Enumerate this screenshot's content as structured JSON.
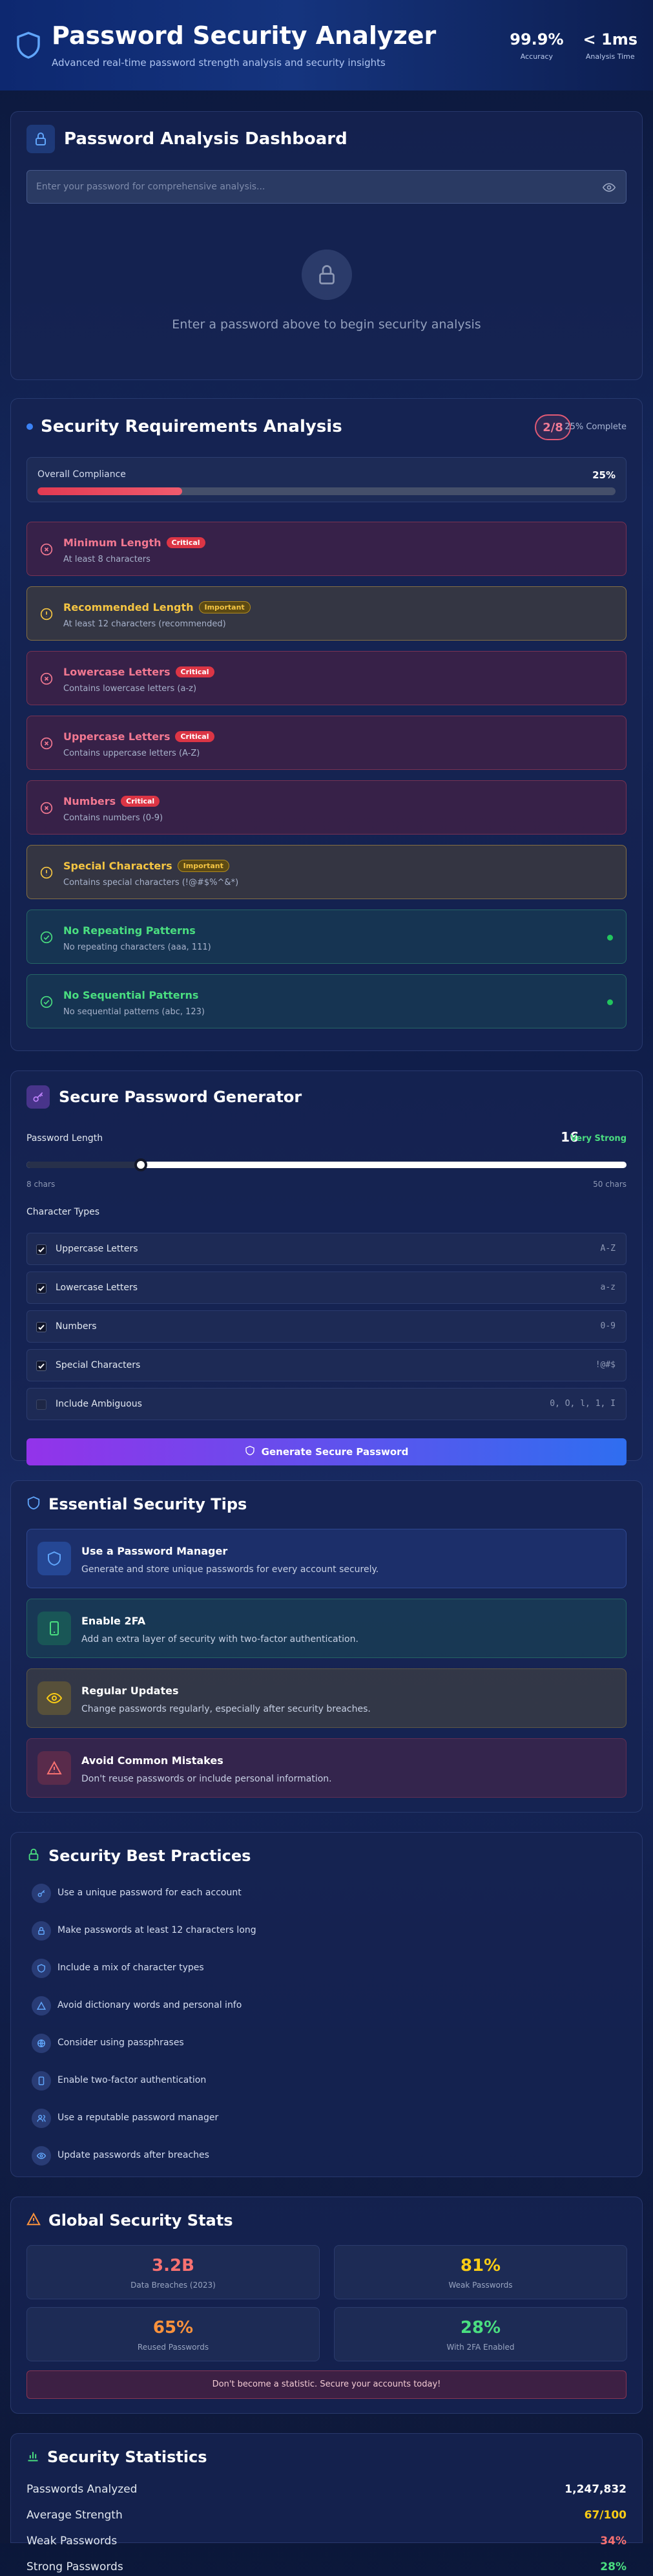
{
  "header": {
    "title": "Password Security Analyzer",
    "subtitle": "Advanced real-time password strength analysis and security insights",
    "stats": [
      {
        "value": "99.9%",
        "label": "Accuracy"
      },
      {
        "value": "< 1ms",
        "label": "Analysis Time"
      }
    ]
  },
  "dashboard": {
    "title": "Password Analysis Dashboard",
    "input_placeholder": "Enter your password for comprehensive analysis...",
    "input_value": "",
    "empty_text": "Enter a password above to begin security analysis"
  },
  "requirements": {
    "title": "Security Requirements Analysis",
    "badge": "2/8",
    "complete_label": "25% Complete",
    "compliance_label": "Overall Compliance",
    "compliance_pct": "25%",
    "compliance_value": 0.25,
    "items": [
      {
        "name": "Minimum Length",
        "tag": "Critical",
        "desc": "At least 8 characters",
        "status": "fail"
      },
      {
        "name": "Recommended Length",
        "tag": "Important",
        "desc": "At least 12 characters (recommended)",
        "status": "warn"
      },
      {
        "name": "Lowercase Letters",
        "tag": "Critical",
        "desc": "Contains lowercase letters (a-z)",
        "status": "fail"
      },
      {
        "name": "Uppercase Letters",
        "tag": "Critical",
        "desc": "Contains uppercase letters (A-Z)",
        "status": "fail"
      },
      {
        "name": "Numbers",
        "tag": "Critical",
        "desc": "Contains numbers (0-9)",
        "status": "fail"
      },
      {
        "name": "Special Characters",
        "tag": "Important",
        "desc": "Contains special characters (!@#$%^&*)",
        "status": "warn"
      },
      {
        "name": "No Repeating Patterns",
        "tag": "",
        "desc": "No repeating characters (aaa, 111)",
        "status": "pass"
      },
      {
        "name": "No Sequential Patterns",
        "tag": "",
        "desc": "No sequential patterns (abc, 123)",
        "status": "pass"
      }
    ]
  },
  "generator": {
    "title": "Secure Password Generator",
    "length_label": "Password Length",
    "length_value": "16",
    "strength_label": "Very Strong",
    "min_label": "8 chars",
    "max_label": "50 chars",
    "slider_min": 8,
    "slider_max": 50,
    "slider_value": 16,
    "types_label": "Character Types",
    "types": [
      {
        "name": "Uppercase Letters",
        "sample": "A-Z",
        "checked": true
      },
      {
        "name": "Lowercase Letters",
        "sample": "a-z",
        "checked": true
      },
      {
        "name": "Numbers",
        "sample": "0-9",
        "checked": true
      },
      {
        "name": "Special Characters",
        "sample": "!@#$",
        "checked": true
      },
      {
        "name": "Include Ambiguous",
        "sample": "0, O, l, 1, I",
        "checked": false
      }
    ],
    "button_label": "Generate Secure Password"
  },
  "tips": {
    "title": "Essential Security Tips",
    "items": [
      {
        "name": "Use a Password Manager",
        "desc": "Generate and store unique passwords for every account securely.",
        "icon": "shield-icon",
        "color": "#3b82f6"
      },
      {
        "name": "Enable 2FA",
        "desc": "Add an extra layer of security with two-factor authentication.",
        "icon": "smartphone-icon",
        "color": "#22c55e"
      },
      {
        "name": "Regular Updates",
        "desc": "Change passwords regularly, especially after security breaches.",
        "icon": "eye-icon",
        "color": "#eab308"
      },
      {
        "name": "Avoid Common Mistakes",
        "desc": "Don't reuse passwords or include personal information.",
        "icon": "warning-icon",
        "color": "#ef4444"
      }
    ]
  },
  "best_practices": {
    "title": "Security Best Practices",
    "items": [
      {
        "text": "Use a unique password for each account",
        "icon": "key-icon"
      },
      {
        "text": "Make passwords at least 12 characters long",
        "icon": "lock-icon"
      },
      {
        "text": "Include a mix of character types",
        "icon": "shield-icon"
      },
      {
        "text": "Avoid dictionary words and personal info",
        "icon": "warning-icon"
      },
      {
        "text": "Consider using passphrases",
        "icon": "globe-icon"
      },
      {
        "text": "Enable two-factor authentication",
        "icon": "smartphone-icon"
      },
      {
        "text": "Use a reputable password manager",
        "icon": "users-icon"
      },
      {
        "text": "Update passwords after breaches",
        "icon": "eye-icon"
      }
    ]
  },
  "global_stats": {
    "title": "Global Security Stats",
    "items": [
      {
        "value": "3.2B",
        "label": "Data Breaches (2023)",
        "color": "#f87171"
      },
      {
        "value": "81%",
        "label": "Weak Passwords",
        "color": "#facc15"
      },
      {
        "value": "65%",
        "label": "Reused Passwords",
        "color": "#fb923c"
      },
      {
        "value": "28%",
        "label": "With 2FA Enabled",
        "color": "#4ade80"
      }
    ],
    "warning": "Don't become a statistic. Secure your accounts today!"
  },
  "stats": {
    "title": "Security Statistics",
    "rows": [
      {
        "label": "Passwords Analyzed",
        "value": "1,247,832",
        "color": "#ffffff"
      },
      {
        "label": "Average Strength",
        "value": "67/100",
        "color": "#facc15"
      },
      {
        "label": "Weak Passwords",
        "value": "34%",
        "color": "#f87171"
      },
      {
        "label": "Strong Passwords",
        "value": "28%",
        "color": "#4ade80"
      }
    ]
  }
}
